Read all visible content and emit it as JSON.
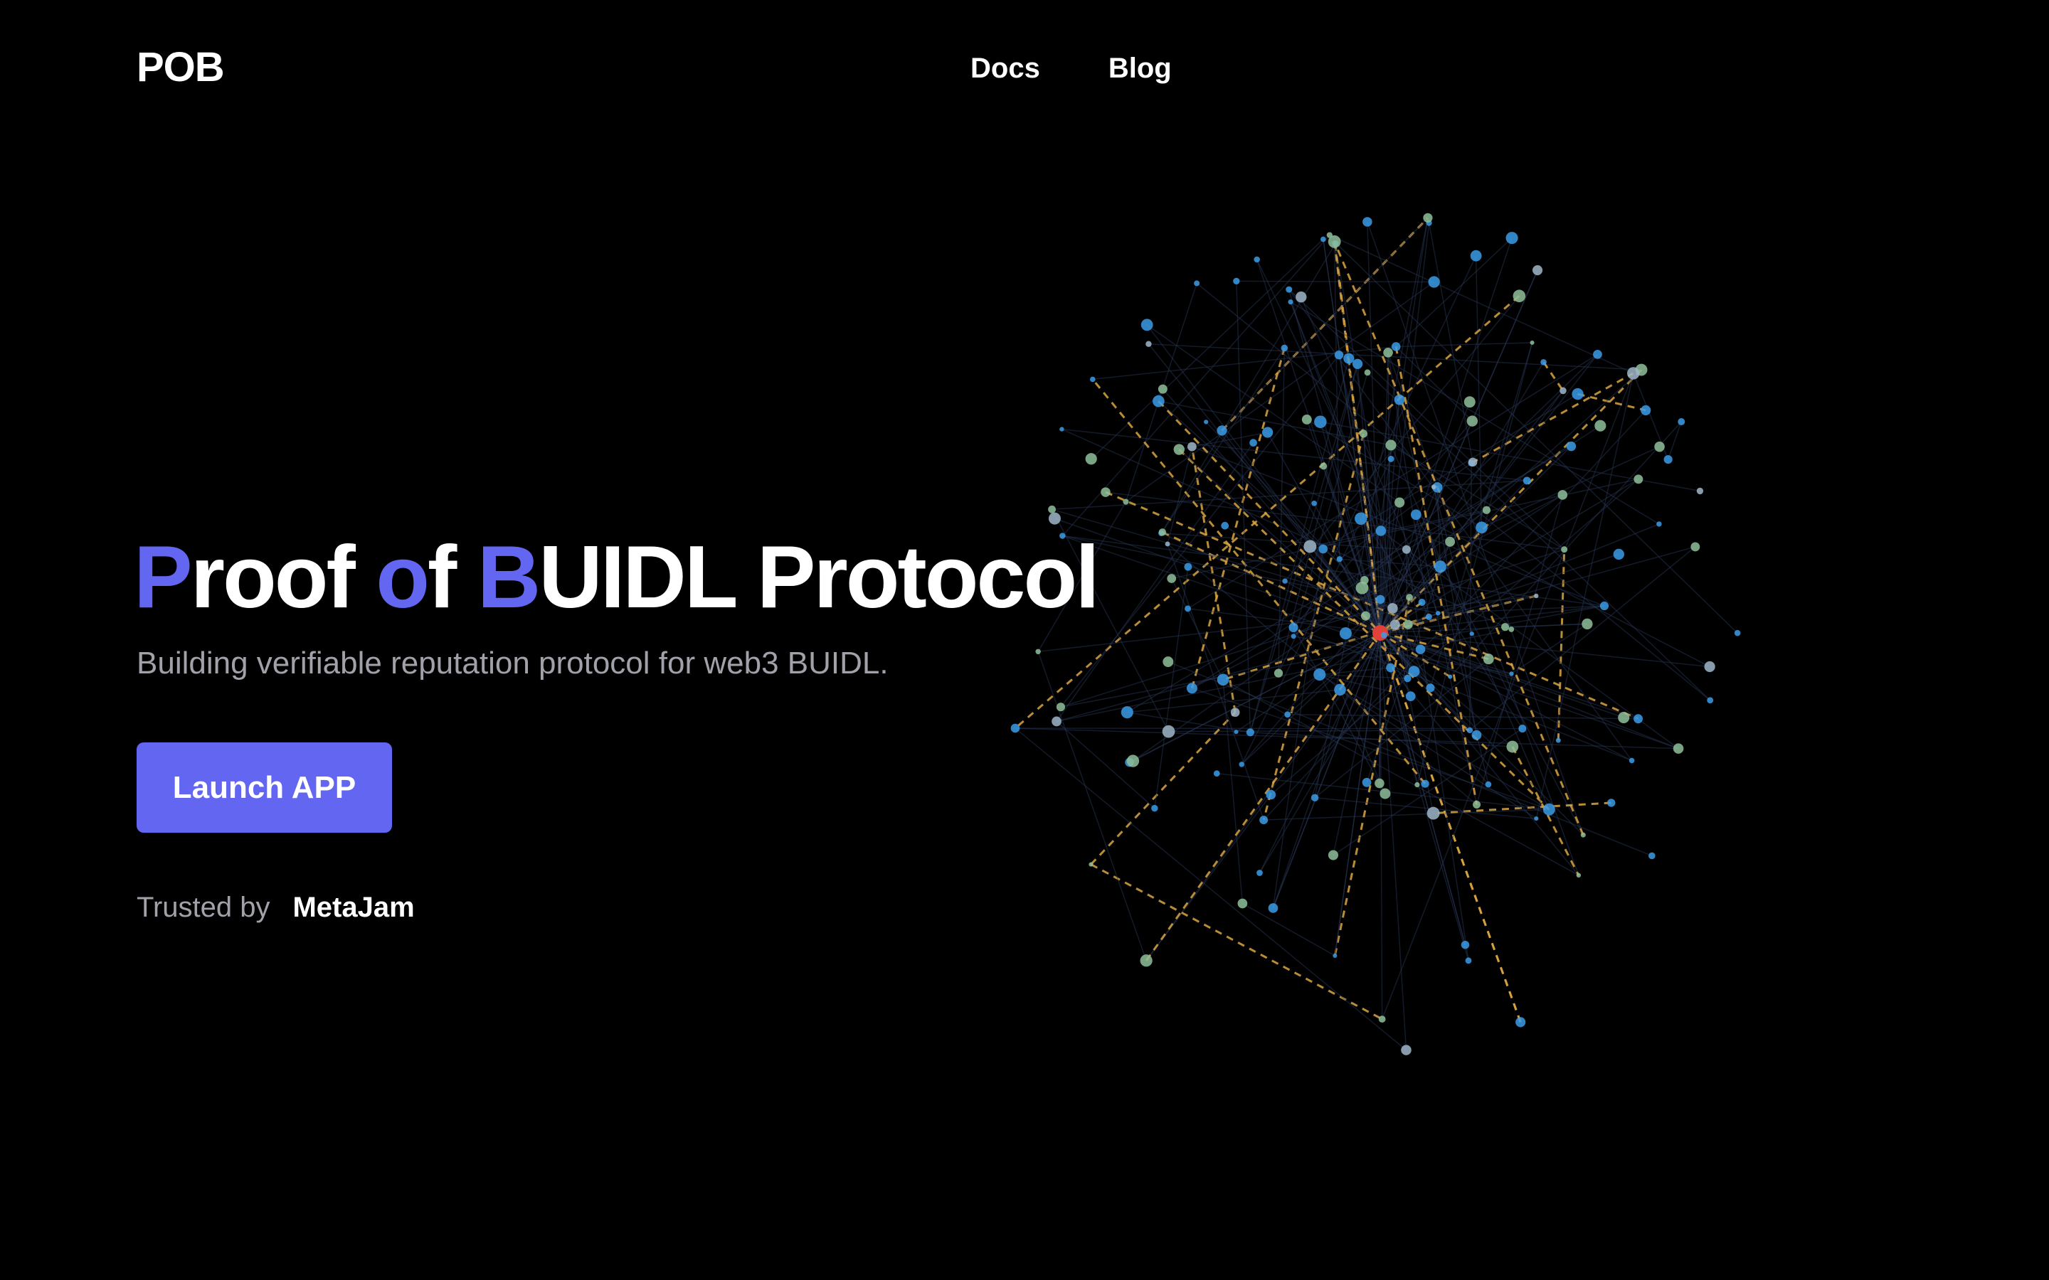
{
  "header": {
    "logo": "POB",
    "nav": [
      {
        "label": "Docs"
      },
      {
        "label": "Blog"
      }
    ]
  },
  "hero": {
    "title_parts": [
      "P",
      "roof ",
      "o",
      "f ",
      "B",
      "UIDL Protocol"
    ],
    "subtitle": "Building verifiable reputation protocol for web3 BUIDL.",
    "cta_label": "Launch APP",
    "trusted_label": "Trusted by",
    "trusted_brand": "MetaJam"
  },
  "colors": {
    "accent": "#6366f1",
    "background": "#000000",
    "muted_text": "#a1a1aa",
    "node_blue": "#3b9ce8",
    "node_green": "#8fbf9a",
    "edge_orange": "#d9a441",
    "center_node": "#e0413a"
  },
  "icons": {
    "network_graph": "network-graph-illustration"
  }
}
